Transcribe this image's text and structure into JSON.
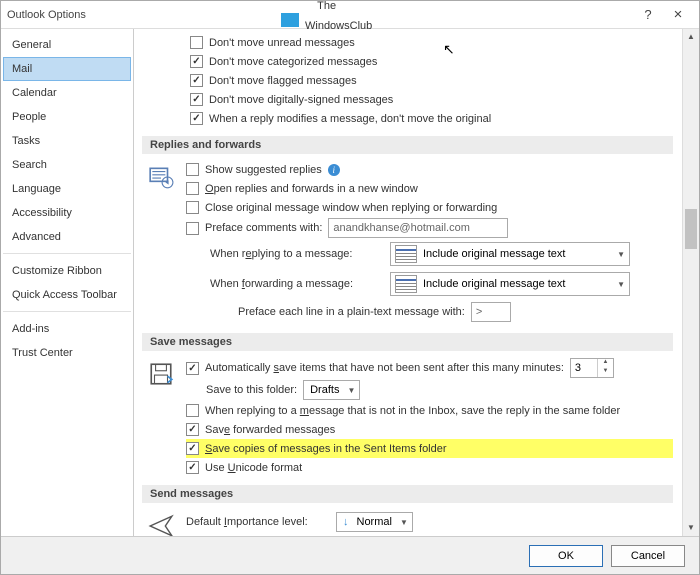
{
  "window": {
    "title": "Outlook Options",
    "help": "?",
    "close": "×"
  },
  "watermark": {
    "line1": "The",
    "line2": "WindowsClub"
  },
  "sidebar": {
    "items": [
      {
        "label": "General"
      },
      {
        "label": "Mail"
      },
      {
        "label": "Calendar"
      },
      {
        "label": "People"
      },
      {
        "label": "Tasks"
      },
      {
        "label": "Search"
      },
      {
        "label": "Language"
      },
      {
        "label": "Accessibility"
      },
      {
        "label": "Advanced"
      },
      {
        "label": "Customize Ribbon"
      },
      {
        "label": "Quick Access Toolbar"
      },
      {
        "label": "Add-ins"
      },
      {
        "label": "Trust Center"
      }
    ]
  },
  "top_checks": [
    {
      "checked": false,
      "label": "Don't move unread messages"
    },
    {
      "checked": true,
      "label": "Don't move categorized messages"
    },
    {
      "checked": true,
      "label": "Don't move flagged messages"
    },
    {
      "checked": true,
      "label": "Don't move digitally-signed messages"
    },
    {
      "checked": true,
      "label": "When a reply modifies a message, don't move the original"
    }
  ],
  "replies": {
    "header": "Replies and forwards",
    "show_suggested": {
      "checked": false,
      "label": "Show suggested replies"
    },
    "open_new_window": {
      "checked": false,
      "label": "Open replies and forwards in a new window"
    },
    "close_original": {
      "checked": false,
      "label": "Close original message window when replying or forwarding"
    },
    "preface_comments": {
      "checked": false,
      "label": "Preface comments with:",
      "value": "anandkhanse@hotmail.com"
    },
    "when_reply_label": "When replying to a message:",
    "when_reply_value": "Include original message text",
    "when_fwd_label": "When forwarding a message:",
    "when_fwd_value": "Include original message text",
    "preface_each_label": "Preface each line in a plain-text message with:",
    "preface_each_value": ">"
  },
  "save": {
    "header": "Save messages",
    "auto_save": {
      "checked": true,
      "label": "Automatically save items that have not been sent after this many minutes:",
      "value": "3"
    },
    "folder_label": "Save to this folder:",
    "folder_value": "Drafts",
    "reply_same_folder": {
      "checked": false,
      "label": "When replying to a message that is not in the Inbox, save the reply in the same folder"
    },
    "save_fwd": {
      "checked": true,
      "label": "Save forwarded messages"
    },
    "save_sent": {
      "checked": true,
      "label": "Save copies of messages in the Sent Items folder"
    },
    "unicode": {
      "checked": true,
      "label": "Use Unicode format"
    }
  },
  "send": {
    "header": "Send messages",
    "importance_label": "Default Importance level:",
    "importance_value": "Normal"
  },
  "footer": {
    "ok": "OK",
    "cancel": "Cancel"
  }
}
